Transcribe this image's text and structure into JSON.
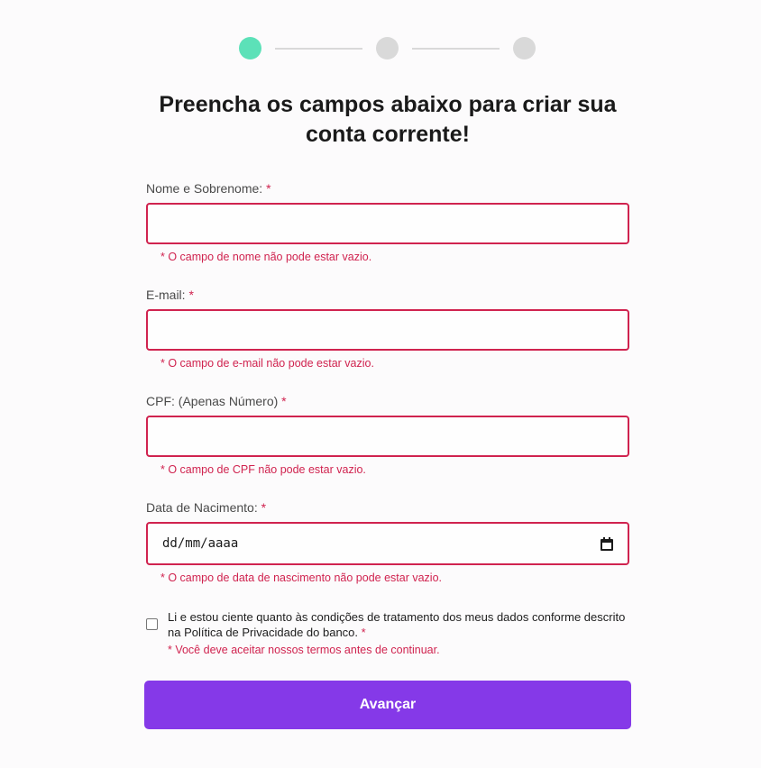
{
  "stepper": {
    "steps": [
      {
        "state": "active",
        "color": "#5ce1b8"
      },
      {
        "state": "inactive",
        "color": "#d9d9d9"
      },
      {
        "state": "inactive",
        "color": "#d9d9d9"
      }
    ]
  },
  "form": {
    "title": "Preencha os campos abaixo para criar sua conta corrente!",
    "required_marker": "*",
    "fields": {
      "name": {
        "label": "Nome e Sobrenome:",
        "value": "",
        "error": "* O campo de nome não pode estar vazio."
      },
      "email": {
        "label": "E-mail:",
        "value": "",
        "error": "* O campo de e-mail não pode estar vazio."
      },
      "cpf": {
        "label": "CPF: (Apenas Número)",
        "value": "",
        "error": "* O campo de CPF não pode estar vazio."
      },
      "birthdate": {
        "label": "Data de Nacimento:",
        "placeholder": "dd/mm/aaaa",
        "icon": "calendar-icon",
        "error": "* O campo de data de nascimento não pode estar vazio."
      }
    },
    "consent": {
      "checked": false,
      "text": "Li e estou ciente quanto às condições de tratamento dos meus dados conforme descrito na Política de Privacidade do banco.",
      "error": "* Você deve aceitar nossos termos antes de continuar."
    },
    "submit_label": "Avançar"
  },
  "colors": {
    "accent": "#8539e8",
    "error": "#d0234f",
    "step_active": "#5ce1b8",
    "step_inactive": "#d9d9d9"
  }
}
